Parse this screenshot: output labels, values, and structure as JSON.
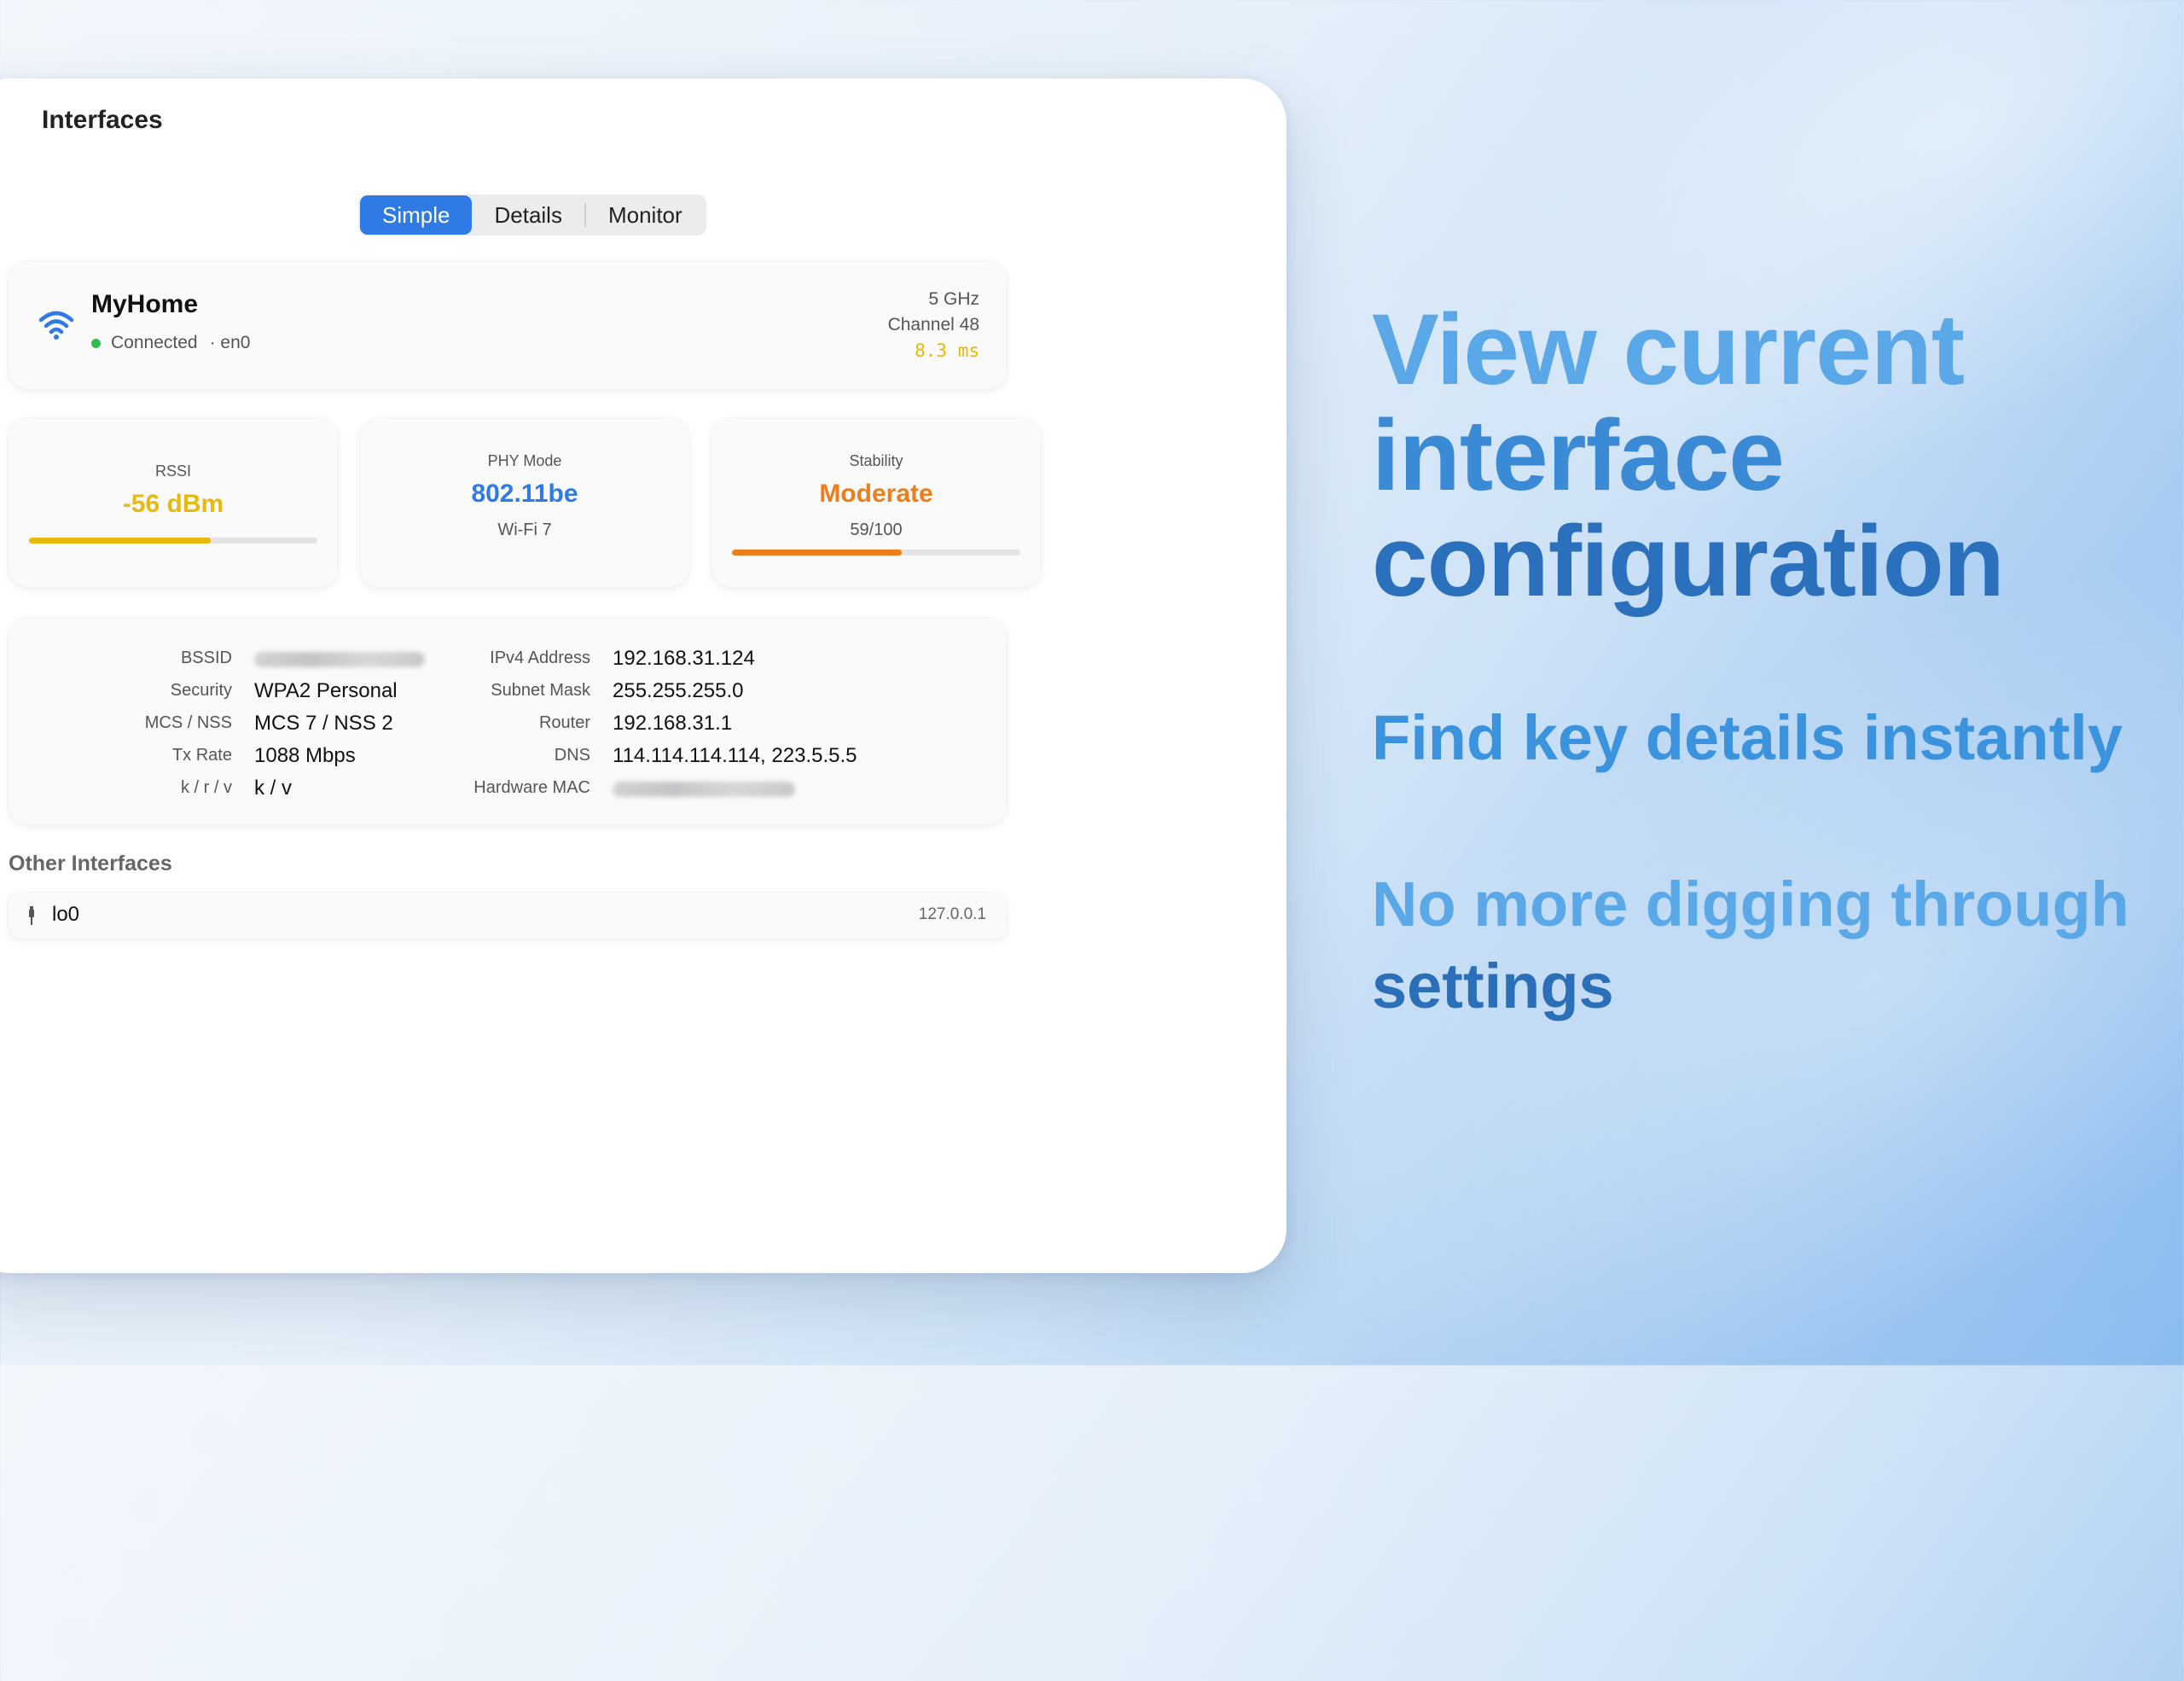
{
  "window": {
    "title": "Interfaces",
    "tabs": [
      {
        "label": "Simple",
        "active": true
      },
      {
        "label": "Details",
        "active": false
      },
      {
        "label": "Monitor",
        "active": false
      }
    ]
  },
  "network": {
    "ssid": "MyHome",
    "status": "Connected",
    "interface": "· en0",
    "band": "5 GHz",
    "channel": "Channel 48",
    "latency": "8.3 ms",
    "status_color": "#2ebd4f"
  },
  "stats": {
    "rssi": {
      "label": "RSSI",
      "value": "-56 dBm",
      "level": 0.63,
      "color": "#e8b90e"
    },
    "phy": {
      "label": "PHY Mode",
      "value": "802.11be",
      "sub": "Wi-Fi 7",
      "color": "#2f7ae5"
    },
    "stability": {
      "label": "Stability",
      "value": "Moderate",
      "sub": "59/100",
      "level": 0.59,
      "color": "#ee7d1b"
    }
  },
  "details": {
    "left": [
      {
        "label": "BSSID",
        "value": "",
        "blurred": true
      },
      {
        "label": "Security",
        "value": "WPA2 Personal"
      },
      {
        "label": "MCS / NSS",
        "value": "MCS 7 / NSS 2"
      },
      {
        "label": "Tx Rate",
        "value": "1088 Mbps"
      },
      {
        "label": "k / r / v",
        "value": "k / v"
      }
    ],
    "right": [
      {
        "label": "IPv4 Address",
        "value": "192.168.31.124"
      },
      {
        "label": "Subnet Mask",
        "value": "255.255.255.0"
      },
      {
        "label": "Router",
        "value": "192.168.31.1"
      },
      {
        "label": "DNS",
        "value": "114.114.114.114, 223.5.5.5"
      },
      {
        "label": "Hardware MAC",
        "value": "",
        "blurred": true
      }
    ]
  },
  "other": {
    "title": "Other Interfaces",
    "items": [
      {
        "name": "lo0",
        "address": "127.0.0.1"
      }
    ]
  },
  "marketing": {
    "headline": [
      "View current",
      "interface",
      "configuration"
    ],
    "tagline1": "Find key details instantly",
    "tagline2": [
      "No more digging through",
      "settings"
    ]
  },
  "colors": {
    "accent": "#2f7ae5",
    "headline_light": "#5aa8e8",
    "headline_dark": "#2a70bd"
  }
}
